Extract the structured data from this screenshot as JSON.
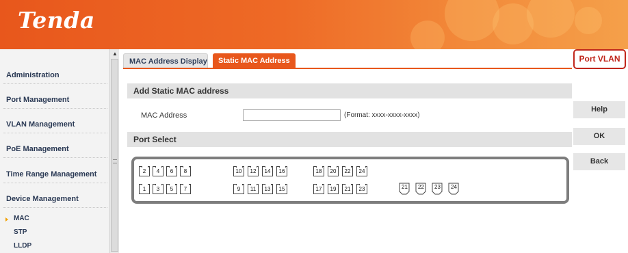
{
  "header": {
    "logo": "Tenda"
  },
  "sidebar": {
    "items": [
      {
        "label": "Administration"
      },
      {
        "label": "Port Management"
      },
      {
        "label": "VLAN Management"
      },
      {
        "label": "PoE Management"
      },
      {
        "label": "Time Range Management"
      },
      {
        "label": "Device Management"
      }
    ],
    "sub_items": [
      {
        "label": "MAC",
        "active": true
      },
      {
        "label": "STP"
      },
      {
        "label": "LLDP"
      }
    ]
  },
  "tabs": [
    {
      "label": "MAC Address Display",
      "active": false
    },
    {
      "label": "Static MAC Address",
      "active": true
    }
  ],
  "right_buttons": {
    "port_vlan": "Port VLAN",
    "help": "Help",
    "ok": "OK",
    "back": "Back"
  },
  "form": {
    "section_title": "Add Static MAC address",
    "mac_label": "MAC Address",
    "mac_value": "",
    "mac_format": "(Format: xxxx-xxxx-xxxx)",
    "port_section_title": "Port Select"
  },
  "ports": {
    "top_row": [
      "2",
      "4",
      "6",
      "8",
      "10",
      "12",
      "14",
      "16",
      "18",
      "20",
      "22",
      "24"
    ],
    "bottom_row": [
      "1",
      "3",
      "5",
      "7",
      "9",
      "11",
      "13",
      "15",
      "17",
      "19",
      "21",
      "23"
    ],
    "combo_ports": [
      "21",
      "22",
      "23",
      "24"
    ]
  },
  "colors": {
    "brand": "#e8571c",
    "highlight": "#c0251a"
  }
}
